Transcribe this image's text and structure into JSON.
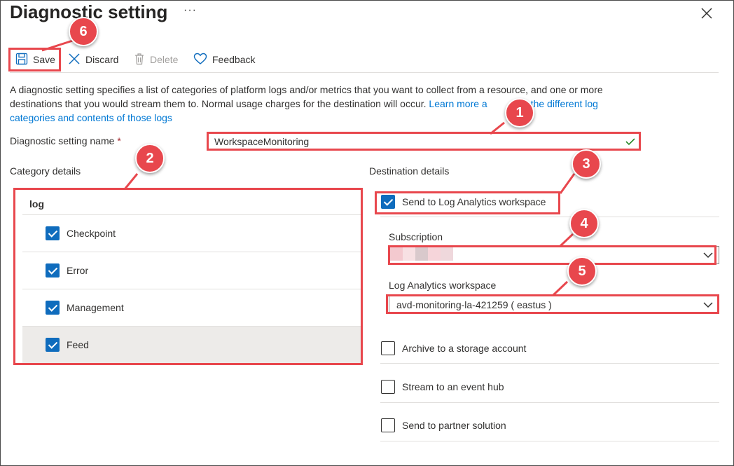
{
  "header": {
    "title": "Diagnostic setting",
    "more": "···"
  },
  "toolbar": {
    "save_label": "Save",
    "discard_label": "Discard",
    "delete_label": "Delete",
    "feedback_label": "Feedback"
  },
  "description": {
    "text": "A diagnostic setting specifies a list of categories of platform logs and/or metrics that you want to collect from a resource, and one or more destinations that you would stream them to. Normal usage charges for the destination will occur.",
    "link_part1": "Learn more a",
    "link_part2": "the different log categories and contents of those logs"
  },
  "setting_name": {
    "label": "Diagnostic setting name",
    "required_mark": "*",
    "value": "WorkspaceMonitoring"
  },
  "category_details": {
    "heading": "Category details",
    "group": "log",
    "items": [
      {
        "label": "Checkpoint",
        "checked": true
      },
      {
        "label": "Error",
        "checked": true
      },
      {
        "label": "Management",
        "checked": true
      },
      {
        "label": "Feed",
        "checked": true
      }
    ]
  },
  "destination_details": {
    "heading": "Destination details",
    "send_to_log_analytics": "Send to Log Analytics workspace",
    "subscription_label": "Subscription",
    "subscription_value": "",
    "workspace_label": "Log Analytics workspace",
    "workspace_value": "avd-monitoring-la-421259 ( eastus )",
    "archive": "Archive to a storage account",
    "stream": "Stream to an event hub",
    "partner": "Send to partner solution"
  },
  "annotations": [
    "1",
    "2",
    "3",
    "4",
    "5",
    "6"
  ],
  "colors": {
    "accent": "#0f6cbd",
    "link": "#0078d4",
    "annotation": "#e8474d",
    "success": "#107c10"
  }
}
